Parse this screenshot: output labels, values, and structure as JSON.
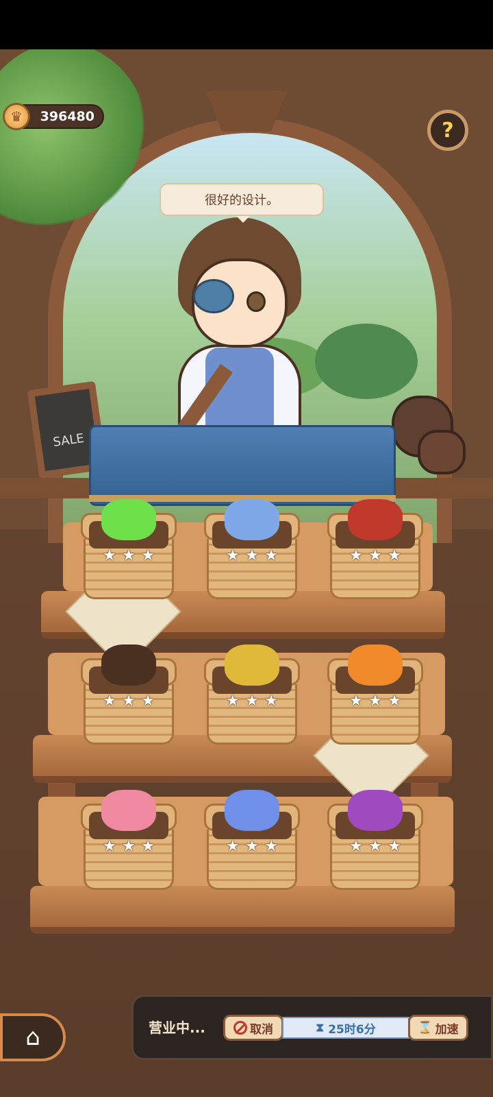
{
  "hud": {
    "coins": "396480",
    "coin_icon": "coin-icon",
    "help_icon": "question-icon"
  },
  "speech": "很好的设计。",
  "sign_text": "SALE",
  "shelf": {
    "rows": [
      [
        {
          "item": "green-moss",
          "stars": 3
        },
        {
          "item": "blue-candle",
          "stars": 3
        },
        {
          "item": "red-bow",
          "stars": 3
        }
      ],
      [
        {
          "item": "wooden-wand",
          "stars": 3
        },
        {
          "item": "gold-sack",
          "stars": 3
        },
        {
          "item": "orange-gems",
          "stars": 3
        }
      ],
      [
        {
          "item": "pink-worm",
          "stars": 3
        },
        {
          "item": "blue-flower",
          "stars": 3
        },
        {
          "item": "purple-lantern",
          "stars": 3
        }
      ]
    ],
    "star_glyph": "★"
  },
  "bottom_bar": {
    "status": "营业中...",
    "cancel_label": "取消",
    "timer": "25时6分",
    "speed_label": "加速"
  }
}
